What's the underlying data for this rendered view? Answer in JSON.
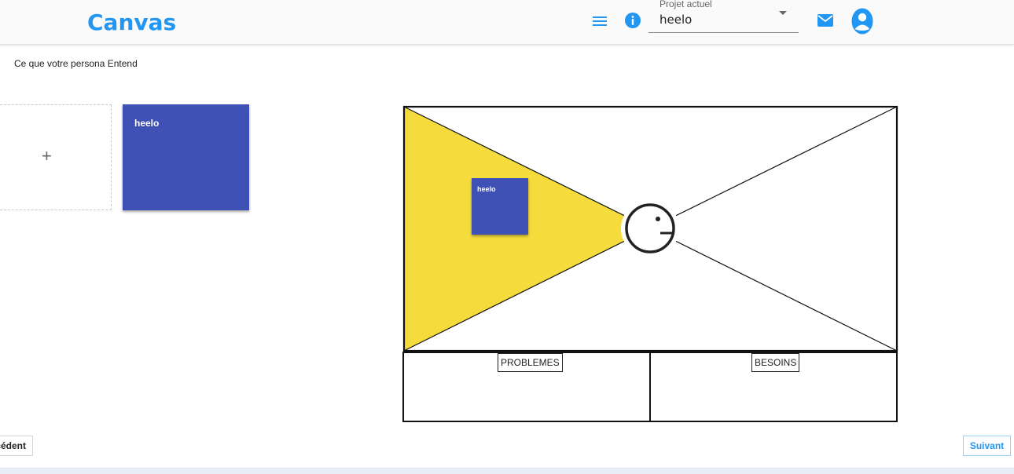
{
  "app": {
    "title": "Canvas",
    "brand_color": "#2196f3"
  },
  "header": {
    "project_label": "Projet actuel",
    "project_value": "heelo",
    "icons": [
      "menu-icon",
      "info-icon",
      "chevron-down-icon",
      "mail-icon",
      "user-avatar-icon"
    ]
  },
  "section": {
    "title": "Ce que votre persona Entend"
  },
  "notes": {
    "add_symbol": "+",
    "items": [
      {
        "text": "heelo",
        "color": "#3f51b5"
      }
    ]
  },
  "canvas": {
    "highlight_color": "#f5dc3c",
    "placed_notes": [
      {
        "text": "heelo",
        "color": "#3f51b5"
      }
    ],
    "bottom_labels": {
      "left": "PROBLEMES",
      "right": "BESOINS"
    }
  },
  "navigation": {
    "prev_label": "écédent",
    "next_label": "Suivant"
  }
}
